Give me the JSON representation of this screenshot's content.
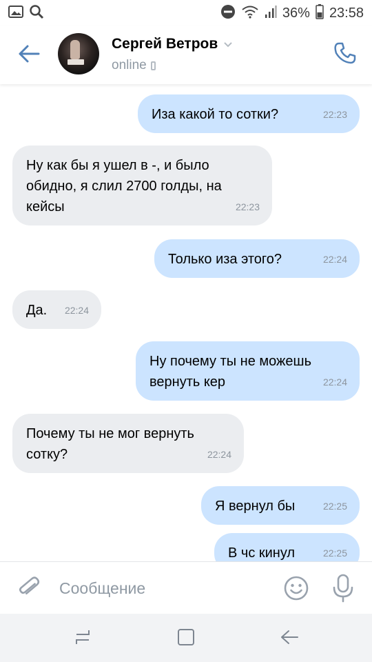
{
  "status_bar": {
    "battery_percent": "36%",
    "time": "23:58"
  },
  "header": {
    "contact_name": "Сергей Ветров",
    "status": "online"
  },
  "messages": [
    {
      "direction": "out",
      "text": "Иза какой то сотки?",
      "time": "22:23"
    },
    {
      "direction": "in",
      "text": "Ну как бы я ушел в -, и было обидно, я слил 2700 голды, на кейсы",
      "time": "22:23"
    },
    {
      "direction": "out",
      "text": "Только иза этого?",
      "time": "22:24"
    },
    {
      "direction": "in",
      "text": "Да.",
      "time": "22:24"
    },
    {
      "direction": "out",
      "text": "Ну почему ты не можешь вернуть кер",
      "time": "22:24"
    },
    {
      "direction": "in",
      "text": "Почему ты не мог вернуть сотку?",
      "time": "22:24"
    },
    {
      "direction": "out",
      "text": "Я вернул бы",
      "time": "22:25"
    },
    {
      "direction": "out",
      "text": "В чс кинул",
      "time": "22:25"
    }
  ],
  "input": {
    "placeholder": "Сообщение"
  },
  "colors": {
    "accent": "#5181b8",
    "outgoing_bubble": "#cce4ff",
    "incoming_bubble": "#ebedf0",
    "meta_text": "#8f99a3"
  },
  "icons": {
    "back": "arrow-left-icon",
    "call": "phone-icon",
    "attach": "paperclip-icon",
    "emoji": "smile-icon",
    "mic": "microphone-icon"
  }
}
